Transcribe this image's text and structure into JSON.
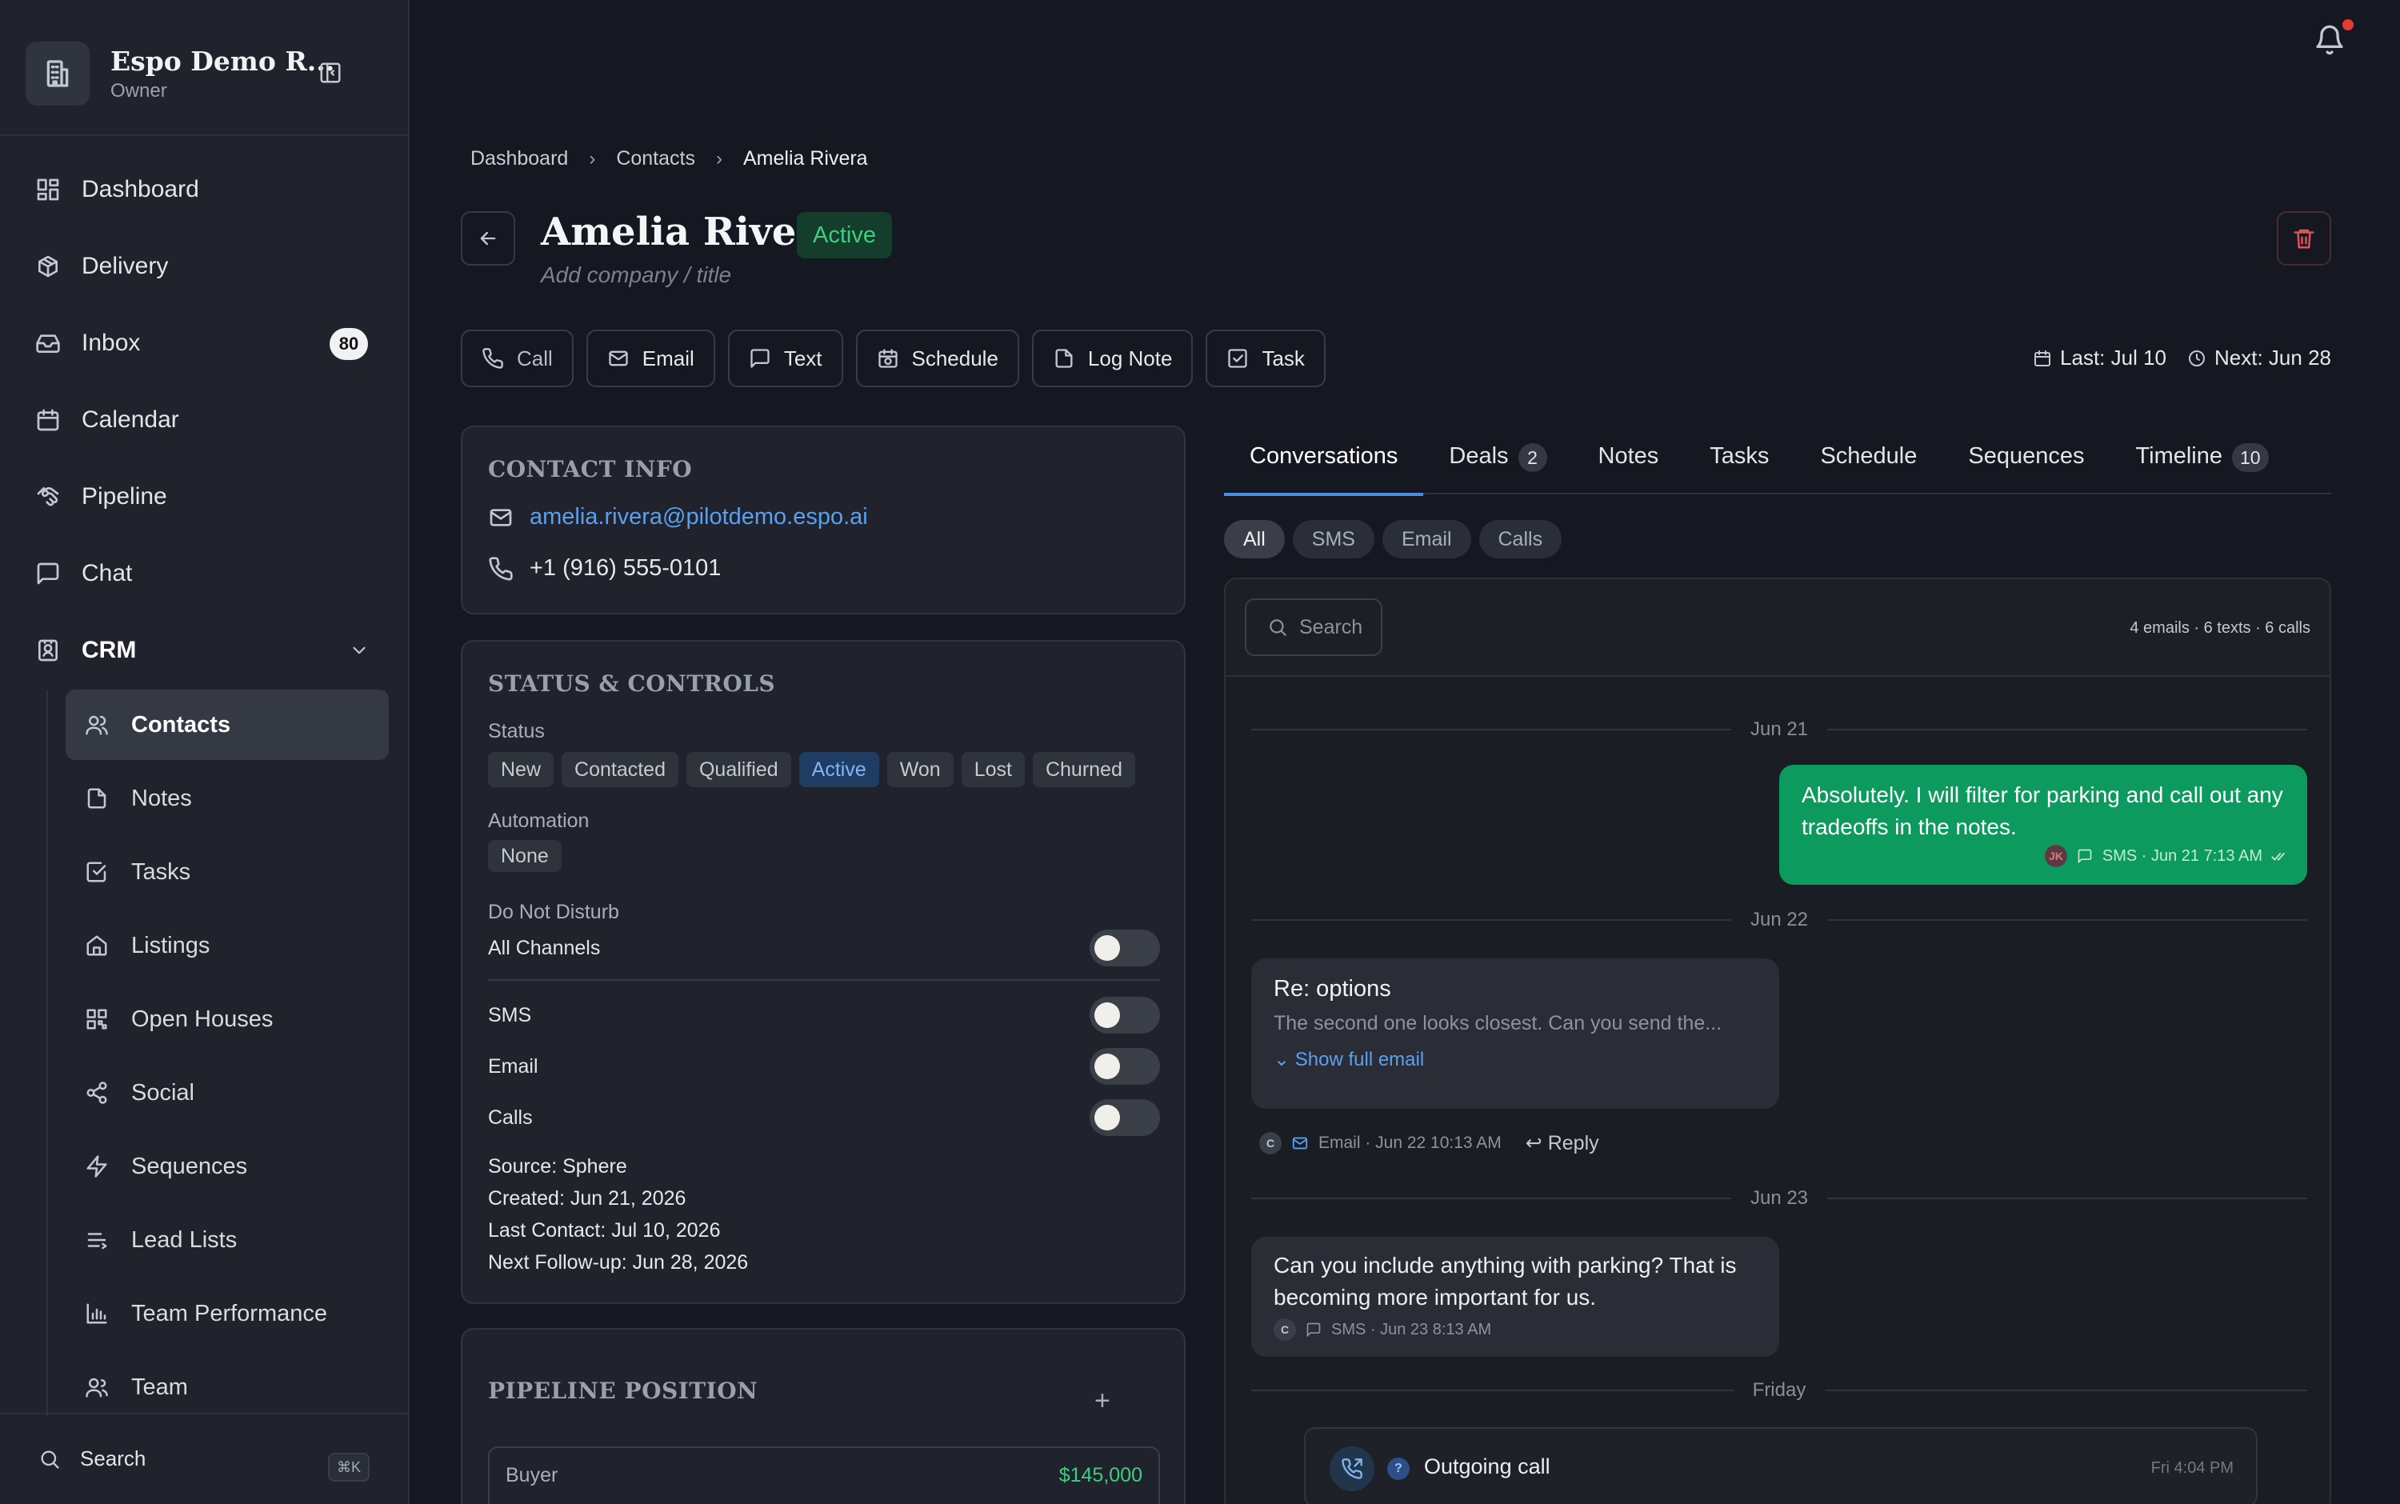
{
  "sidebar": {
    "workspace_name": "Espo Demo R...",
    "workspace_role": "Owner",
    "nav": [
      {
        "label": "Dashboard",
        "icon": "dashboard-icon"
      },
      {
        "label": "Delivery",
        "icon": "package-icon"
      },
      {
        "label": "Inbox",
        "icon": "inbox-icon",
        "badge": "80"
      },
      {
        "label": "Calendar",
        "icon": "calendar-icon"
      },
      {
        "label": "Pipeline",
        "icon": "handshake-icon"
      },
      {
        "label": "Chat",
        "icon": "chat-icon"
      },
      {
        "label": "CRM",
        "icon": "contact-card-icon"
      }
    ],
    "crm_items": [
      {
        "label": "Contacts",
        "icon": "users-icon",
        "active": true
      },
      {
        "label": "Notes",
        "icon": "file-icon"
      },
      {
        "label": "Tasks",
        "icon": "checkbox-icon"
      },
      {
        "label": "Listings",
        "icon": "home-icon"
      },
      {
        "label": "Open Houses",
        "icon": "qr-icon"
      },
      {
        "label": "Social",
        "icon": "share-icon"
      },
      {
        "label": "Sequences",
        "icon": "bolt-icon"
      },
      {
        "label": "Lead Lists",
        "icon": "list-icon"
      },
      {
        "label": "Team Performance",
        "icon": "bar-chart-icon"
      },
      {
        "label": "Team",
        "icon": "team-icon"
      }
    ],
    "search_label": "Search",
    "search_shortcut": "⌘K"
  },
  "breadcrumb": [
    "Dashboard",
    "Contacts",
    "Amelia Rivera"
  ],
  "contact": {
    "name": "Amelia Rivera",
    "status": "Active",
    "subtitle": "Add company / title",
    "last": "Last: Jul 10",
    "next": "Next: Jun 28"
  },
  "actions": [
    "Call",
    "Email",
    "Text",
    "Schedule",
    "Log Note",
    "Task"
  ],
  "contact_info": {
    "title": "CONTACT INFO",
    "email": "amelia.rivera@pilotdemo.espo.ai",
    "phone": "+1 (916) 555-0101"
  },
  "status_controls": {
    "title": "STATUS & CONTROLS",
    "status_label": "Status",
    "statuses": [
      "New",
      "Contacted",
      "Qualified",
      "Active",
      "Won",
      "Lost",
      "Churned"
    ],
    "active_status": "Active",
    "automation_label": "Automation",
    "automation_value": "None",
    "dnd_label": "Do Not Disturb",
    "toggles": [
      "All Channels",
      "SMS",
      "Email",
      "Calls"
    ],
    "source": "Source: Sphere",
    "created": "Created: Jun 21, 2026",
    "last_contact": "Last Contact: Jul 10, 2026",
    "next_followup": "Next Follow-up: Jun 28, 2026"
  },
  "pipeline": {
    "title": "PIPELINE POSITION",
    "plus": "+",
    "role": "Buyer",
    "value": "$145,000"
  },
  "tabs": [
    {
      "label": "Conversations"
    },
    {
      "label": "Deals",
      "count": "2"
    },
    {
      "label": "Notes"
    },
    {
      "label": "Tasks"
    },
    {
      "label": "Schedule"
    },
    {
      "label": "Sequences"
    },
    {
      "label": "Timeline",
      "count": "10"
    }
  ],
  "filters": [
    "All",
    "SMS",
    "Email",
    "Calls"
  ],
  "conversation": {
    "search_placeholder": "Search",
    "counts": "4 emails  ·  6 texts  ·  6 calls",
    "day1": "Jun 21",
    "out_sms_text": "Absolutely. I will filter for parking and call out any tradeoffs in the notes.",
    "out_sms_avatar": "JK",
    "out_sms_meta": "SMS · Jun 21 7:13 AM",
    "day2": "Jun 22",
    "email_subject": "Re: options",
    "email_preview": "The second one looks closest. Can you send the...",
    "email_show": "Show full email",
    "email_avatar": "C",
    "email_meta": "Email · Jun 22 10:13 AM",
    "email_reply": "Reply",
    "day3": "Jun 23",
    "in_sms_text": "Can you include anything with parking? That is becoming more important for us.",
    "in_sms_avatar": "C",
    "in_sms_meta": "SMS · Jun 23 8:13 AM",
    "day4": "Friday",
    "call_badge": "?",
    "call_title": "Outgoing call",
    "call_time": "Fri 4:04 PM"
  },
  "colors": {
    "accent": "#4c8ee6",
    "success": "#3ccf7f",
    "sms_out": "#0d9a5e",
    "danger": "#e53935"
  }
}
